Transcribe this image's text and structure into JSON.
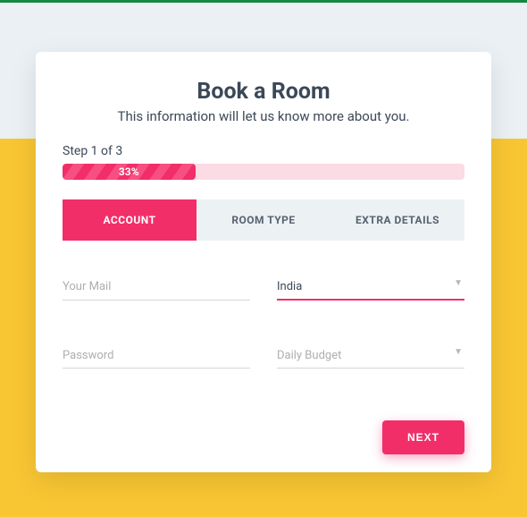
{
  "header": {
    "title": "Book a Room",
    "subtitle": "This information will let us know more about you."
  },
  "progress": {
    "step_label": "Step 1 of 3",
    "percent_text": "33%",
    "percent_value": 33
  },
  "tabs": [
    {
      "label": "ACCOUNT",
      "active": true
    },
    {
      "label": "ROOM TYPE",
      "active": false
    },
    {
      "label": "EXTRA DETAILS",
      "active": false
    }
  ],
  "form": {
    "email_placeholder": "Your Mail",
    "country_value": "India",
    "password_placeholder": "Password",
    "budget_placeholder": "Daily Budget"
  },
  "actions": {
    "next_label": "NEXT"
  }
}
